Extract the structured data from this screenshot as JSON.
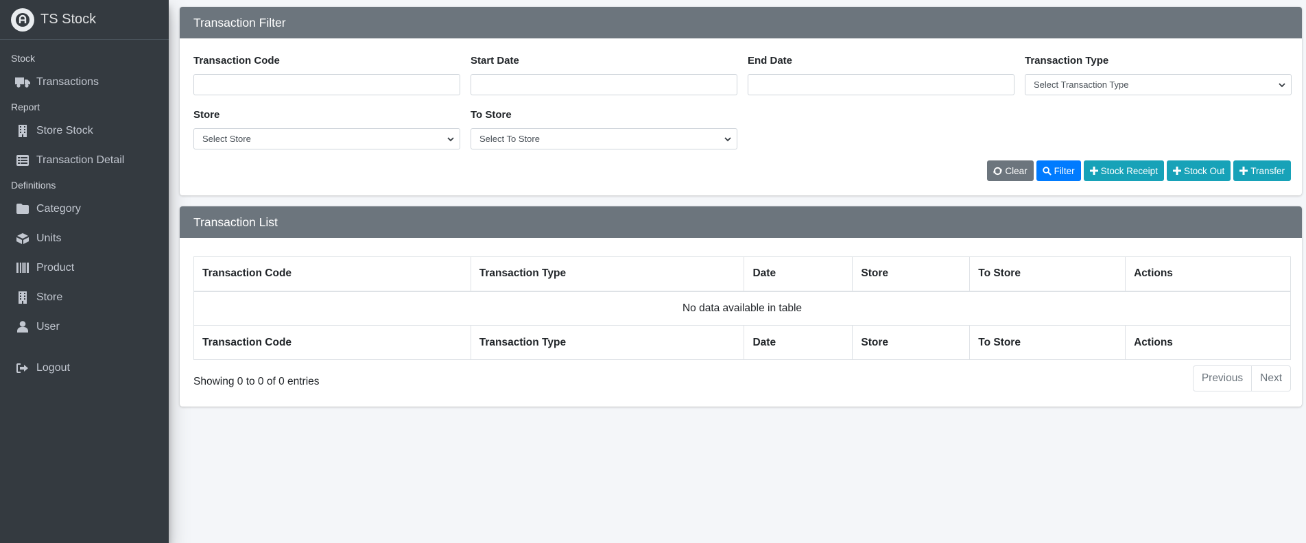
{
  "brand": {
    "title": "TS Stock",
    "logo_icon": "app-logo-icon"
  },
  "sidebar": {
    "sections": [
      {
        "header": "Stock",
        "items": [
          {
            "label": "Transactions",
            "icon": "truck-icon"
          }
        ]
      },
      {
        "header": "Report",
        "items": [
          {
            "label": "Store Stock",
            "icon": "building-icon"
          },
          {
            "label": "Transaction Detail",
            "icon": "list-icon"
          }
        ]
      },
      {
        "header": "Definitions",
        "items": [
          {
            "label": "Category",
            "icon": "folder-icon"
          },
          {
            "label": "Units",
            "icon": "boxes-icon"
          },
          {
            "label": "Product",
            "icon": "barcode-icon"
          },
          {
            "label": "Store",
            "icon": "building-icon"
          },
          {
            "label": "User",
            "icon": "user-icon"
          }
        ]
      }
    ],
    "logout": {
      "label": "Logout",
      "icon": "sign-out-icon"
    }
  },
  "filter": {
    "title": "Transaction Filter",
    "transaction_code": {
      "label": "Transaction Code",
      "value": ""
    },
    "start_date": {
      "label": "Start Date",
      "value": ""
    },
    "end_date": {
      "label": "End Date",
      "value": ""
    },
    "transaction_type": {
      "label": "Transaction Type",
      "selected": "Select Transaction Type"
    },
    "store": {
      "label": "Store",
      "selected": "Select Store"
    },
    "to_store": {
      "label": "To Store",
      "selected": "Select To Store"
    },
    "buttons": {
      "clear": "Clear",
      "filter": "Filter",
      "stock_receipt": "Stock Receipt",
      "stock_out": "Stock Out",
      "transfer": "Transfer"
    }
  },
  "list": {
    "title": "Transaction List",
    "columns": [
      "Transaction Code",
      "Transaction Type",
      "Date",
      "Store",
      "To Store",
      "Actions"
    ],
    "empty_text": "No data available in table",
    "info": "Showing 0 to 0 of 0 entries",
    "pagination": {
      "previous": "Previous",
      "next": "Next"
    }
  },
  "colors": {
    "sidebar_bg": "#343a40",
    "card_header_bg": "#6c757d",
    "primary": "#007bff",
    "info": "#17a2b8",
    "secondary": "#6c757d"
  }
}
